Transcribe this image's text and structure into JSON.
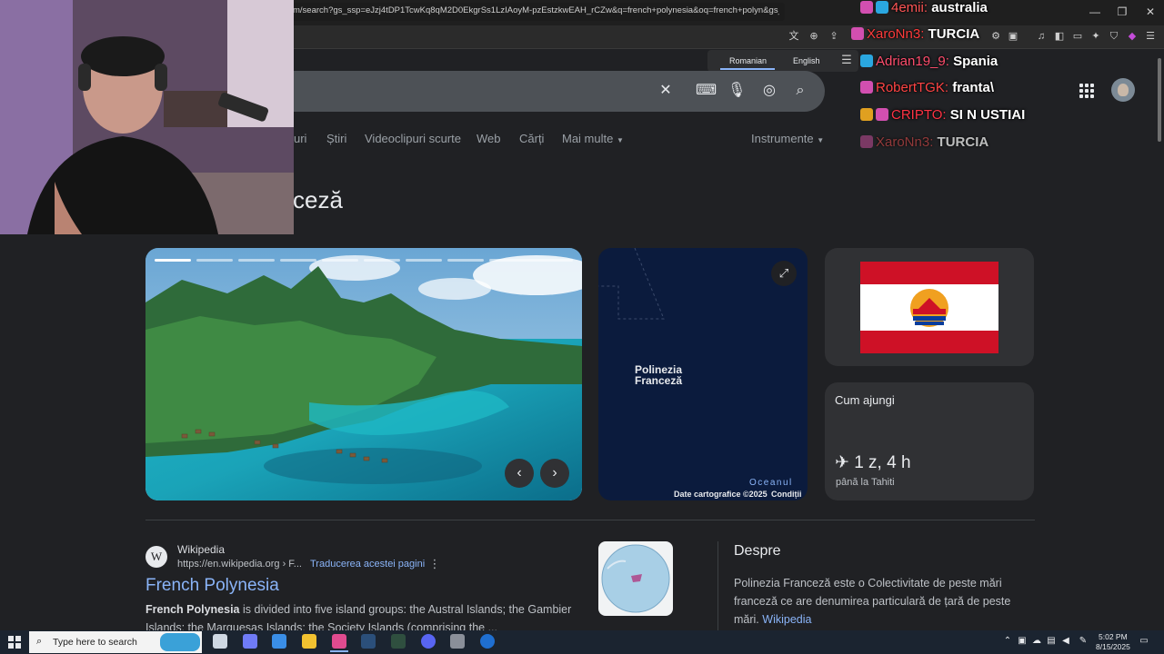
{
  "browser": {
    "url": "m/search?gs_ssp=eJzj4tDP1TcwKq8qM2D0EkgrSs1LzIAoyM-pzEstzkwEAH_rCZw&q=french+polynesia&oq=french+polyn&gs_lc...",
    "new_tab_label": "+"
  },
  "translate": {
    "source_lang": "Romanian",
    "target_lang": "English"
  },
  "search_tabs": [
    "uri",
    "Știri",
    "Videoclipuri scurte",
    "Web",
    "Cărți",
    "Mai multe",
    "Instrumente"
  ],
  "knowledge": {
    "title_visible": "ceză",
    "map": {
      "label_line1": "Polinezia",
      "label_line2": "Franceză",
      "ocean": "Oceanul",
      "credit": "Date cartografice ©2025",
      "terms": "Condiții"
    },
    "travel": {
      "title": "Cum ajungi",
      "time": "1 z, 4 h",
      "destination": "până la Tahiti"
    }
  },
  "result": {
    "site": "Wikipedia",
    "url": "https://en.wikipedia.org › F...",
    "translate_link": "Traducerea acestei pagini",
    "title": "French Polynesia",
    "snippet_bold": "French Polynesia",
    "snippet_rest": " is divided into five island groups: the Austral Islands; the Gambier Islands; the Marquesas Islands; the Society Islands (comprising the ..."
  },
  "about": {
    "heading": "Despre",
    "text": "Polinezia Franceză este o Colectivitate de peste mări franceză ce are denumirea particulară de țară de peste mări.",
    "link": "Wikipedia"
  },
  "chat": [
    {
      "user": "4emii:",
      "message": "australia",
      "color": "#ff5555"
    },
    {
      "user": "XaroNn3:",
      "message": "TURCIA",
      "color": "#ff3b3b"
    },
    {
      "user": "Adrian19_9:",
      "message": "Spania",
      "color": "#ff4d6d"
    },
    {
      "user": "RobertTGK:",
      "message": "franta\\",
      "color": "#ff4444"
    },
    {
      "user": "CRIPTO:",
      "message": "SI N USTIAI",
      "color": "#ff3344"
    },
    {
      "user": "XaroNn3:",
      "message": "TURCIA",
      "color": "#c04444"
    }
  ],
  "taskbar": {
    "search_placeholder": "Type here to search",
    "time": "5:02 PM",
    "date": "8/15/2025"
  },
  "colors": {
    "background": "#202124",
    "link": "#8ab4f8",
    "card": "#303134",
    "map": "#0b1b3d"
  }
}
